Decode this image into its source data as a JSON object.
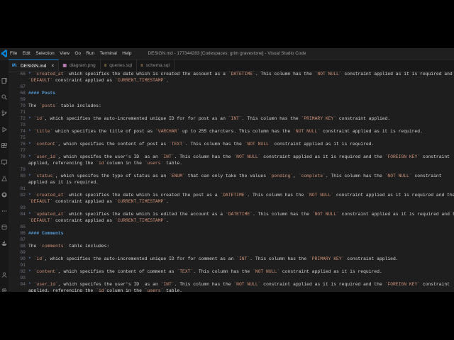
{
  "window": {
    "title": "DESIGN.md - 177344283 [Codespaces: grim gravestone] - Visual Studio Code",
    "menu": [
      "File",
      "Edit",
      "Selection",
      "View",
      "Go",
      "Run",
      "Terminal",
      "Help"
    ]
  },
  "activity_icons": [
    "explorer-icon",
    "search-icon",
    "source-control-icon",
    "run-debug-icon",
    "extensions-icon",
    "remote-explorer-icon",
    "testing-icon",
    "github-icon",
    "ellipsis-icon",
    "database-icon",
    "docker-icon",
    "account-icon",
    "settings-gear-icon"
  ],
  "tabs": [
    {
      "name": "DESIGN.md",
      "icon": "M↓",
      "active": true,
      "close": "×"
    },
    {
      "name": "diagram.png",
      "icon": "▣",
      "active": false
    },
    {
      "name": "queries.sql",
      "icon": "≡",
      "active": false
    },
    {
      "name": "schema.sql",
      "icon": "≡",
      "active": false
    }
  ],
  "editor": {
    "lines": [
      {
        "n": "66",
        "seg": [
          [
            "b",
            "* "
          ],
          [
            "t",
            "`created_at`"
          ],
          [
            "p",
            " which specifies the date which is created the account as a "
          ],
          [
            "t",
            "`DATETIME`"
          ],
          [
            "p",
            ". This column has the "
          ],
          [
            "t",
            "`NOT NULL`"
          ],
          [
            "p",
            " constraint applied as it is required and the"
          ]
        ]
      },
      {
        "n": "",
        "seg": [
          [
            "t",
            "`DEFAULT`"
          ],
          [
            "p",
            " constraint applied as "
          ],
          [
            "t",
            "`CURRENT_TIMESTAMP`"
          ],
          [
            "p",
            "."
          ]
        ]
      },
      {
        "n": "67",
        "seg": []
      },
      {
        "n": "68",
        "seg": [
          [
            "h",
            "#### Posts"
          ]
        ]
      },
      {
        "n": "69",
        "seg": []
      },
      {
        "n": "70",
        "seg": [
          [
            "p",
            "The "
          ],
          [
            "t",
            "`posts`"
          ],
          [
            "p",
            " table includes:"
          ]
        ]
      },
      {
        "n": "71",
        "seg": []
      },
      {
        "n": "72",
        "seg": [
          [
            "b",
            "* "
          ],
          [
            "t",
            "`id`"
          ],
          [
            "p",
            ", which specifies the auto-incremented unique ID for for post as an "
          ],
          [
            "t",
            "`INT`"
          ],
          [
            "p",
            ". This column has the "
          ],
          [
            "t",
            "`PRIMARY KEY`"
          ],
          [
            "p",
            " constraint applied."
          ]
        ]
      },
      {
        "n": "73",
        "seg": []
      },
      {
        "n": "74",
        "seg": [
          [
            "b",
            "* "
          ],
          [
            "t",
            "`title`"
          ],
          [
            "p",
            " which specifies the title of post as "
          ],
          [
            "t",
            "`VARCHAR`"
          ],
          [
            "p",
            " up to 255 charcters. This column has the "
          ],
          [
            "t",
            "`NOT NULL`"
          ],
          [
            "p",
            " constraint applied as it is required."
          ]
        ]
      },
      {
        "n": "75",
        "seg": []
      },
      {
        "n": "76",
        "seg": [
          [
            "b",
            "* "
          ],
          [
            "t",
            "`content`"
          ],
          [
            "p",
            ", which specifies the content of post as "
          ],
          [
            "t",
            "`TEXT`"
          ],
          [
            "p",
            ". This column has the "
          ],
          [
            "t",
            "`NOT NULL`"
          ],
          [
            "p",
            " constraint applied as it is required."
          ]
        ]
      },
      {
        "n": "77",
        "seg": []
      },
      {
        "n": "78",
        "seg": [
          [
            "b",
            "* "
          ],
          [
            "t",
            "`user_id`"
          ],
          [
            "p",
            ", which specifes the user's ID  as an "
          ],
          [
            "t",
            "`INT`"
          ],
          [
            "p",
            ". This column has the "
          ],
          [
            "t",
            "`NOT NULL`"
          ],
          [
            "p",
            " constraint applied as it is required and the "
          ],
          [
            "t",
            "`FOREIGN KEY`"
          ],
          [
            "p",
            " constraint"
          ]
        ]
      },
      {
        "n": "",
        "seg": [
          [
            "p",
            "applied, referencing the "
          ],
          [
            "t",
            "`id`"
          ],
          [
            "p",
            "column in the "
          ],
          [
            "t",
            "`users`"
          ],
          [
            "p",
            " table."
          ]
        ]
      },
      {
        "n": "79",
        "seg": []
      },
      {
        "n": "80",
        "seg": [
          [
            "b",
            "* "
          ],
          [
            "t",
            "`status`"
          ],
          [
            "p",
            ", which specifes the type of status as an "
          ],
          [
            "t",
            "`ENUM`"
          ],
          [
            "p",
            " that can only take the values "
          ],
          [
            "t",
            "`pending`"
          ],
          [
            "p",
            ", "
          ],
          [
            "t",
            "`complete`"
          ],
          [
            "p",
            ". This column has the "
          ],
          [
            "t",
            "`NOT NULL`"
          ],
          [
            "p",
            " constraint"
          ]
        ]
      },
      {
        "n": "",
        "seg": [
          [
            "p",
            "applied as it is required."
          ]
        ]
      },
      {
        "n": "81",
        "seg": []
      },
      {
        "n": "82",
        "seg": [
          [
            "b",
            "* "
          ],
          [
            "t",
            "`created_at`"
          ],
          [
            "p",
            " which specifies the date which is created the post as a "
          ],
          [
            "t",
            "`DATETIME`"
          ],
          [
            "p",
            ". This column has the "
          ],
          [
            "t",
            "`NOT NULL`"
          ],
          [
            "p",
            " constraint applied as it is required and the"
          ]
        ]
      },
      {
        "n": "",
        "seg": [
          [
            "t",
            "`DEFAULT`"
          ],
          [
            "p",
            " constraint applied as "
          ],
          [
            "t",
            "`CURRENT_TIMESTAMP`"
          ],
          [
            "p",
            "."
          ]
        ]
      },
      {
        "n": "83",
        "seg": []
      },
      {
        "n": "84",
        "seg": [
          [
            "b",
            "* "
          ],
          [
            "t",
            "`updated_at`"
          ],
          [
            "p",
            " which specifies the date which is edited the account as a "
          ],
          [
            "t",
            "`DATETIME`"
          ],
          [
            "p",
            ". This column has the "
          ],
          [
            "t",
            "`NOT NULL`"
          ],
          [
            "p",
            " constraint applied as it is required and the"
          ]
        ]
      },
      {
        "n": "",
        "seg": [
          [
            "t",
            "`DEFAULT`"
          ],
          [
            "p",
            " constraint applied as "
          ],
          [
            "t",
            "`CURRENT_TIMESTAMP`"
          ],
          [
            "p",
            "."
          ]
        ]
      },
      {
        "n": "85",
        "seg": []
      },
      {
        "n": "86",
        "seg": [
          [
            "h",
            "#### Comments"
          ]
        ]
      },
      {
        "n": "87",
        "seg": []
      },
      {
        "n": "88",
        "seg": [
          [
            "p",
            "The "
          ],
          [
            "t",
            "`comments`"
          ],
          [
            "p",
            " table includes:"
          ]
        ]
      },
      {
        "n": "89",
        "seg": []
      },
      {
        "n": "90",
        "seg": [
          [
            "b",
            "* "
          ],
          [
            "t",
            "`id`"
          ],
          [
            "p",
            ", which specifies the auto-incremented unique ID for for comment as an "
          ],
          [
            "t",
            "`INT`"
          ],
          [
            "p",
            ". This column has the "
          ],
          [
            "t",
            "`PRIMARY KEY`"
          ],
          [
            "p",
            " constraint applied."
          ]
        ]
      },
      {
        "n": "91",
        "seg": []
      },
      {
        "n": "92",
        "seg": [
          [
            "b",
            "* "
          ],
          [
            "t",
            "`content`"
          ],
          [
            "p",
            ", which specifies the content of comment as "
          ],
          [
            "t",
            "`TEXT`"
          ],
          [
            "p",
            ". This column has the "
          ],
          [
            "t",
            "`NOT NULL`"
          ],
          [
            "p",
            " constraint applied as it is required."
          ]
        ]
      },
      {
        "n": "93",
        "seg": []
      },
      {
        "n": "94",
        "seg": [
          [
            "b",
            "* "
          ],
          [
            "t",
            "`user_id`"
          ],
          [
            "p",
            ", which specifes the user's ID  as an "
          ],
          [
            "t",
            "`INT`"
          ],
          [
            "p",
            ". This column has the "
          ],
          [
            "t",
            "`NOT NULL`"
          ],
          [
            "p",
            " constraint applied as it is required and the "
          ],
          [
            "t",
            "`FOREIGN KEY`"
          ],
          [
            "p",
            " constraint"
          ]
        ]
      },
      {
        "n": "",
        "seg": [
          [
            "p",
            "applied, referencing the "
          ],
          [
            "t",
            "`id`"
          ],
          [
            "p",
            "column in the "
          ],
          [
            "t",
            "`users`"
          ],
          [
            "p",
            " table."
          ]
        ]
      }
    ]
  },
  "colors": {
    "bg": "#1e1e1e",
    "heading": "#569cd6",
    "inline_code": "#ce9178",
    "text": "#d4d4d4",
    "line_number": "#6e7681",
    "accent": "#0078d4"
  }
}
